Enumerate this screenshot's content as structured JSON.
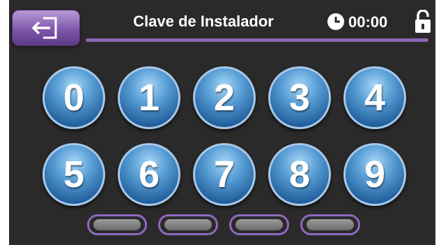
{
  "header": {
    "title": "Clave de Instalador",
    "timer": "00:00",
    "back_icon": "exit-arrow-icon",
    "clock_icon": "clock-icon",
    "lock_icon": "unlocked-padlock-icon"
  },
  "keypad": {
    "keys": [
      "0",
      "1",
      "2",
      "3",
      "4",
      "5",
      "6",
      "7",
      "8",
      "9"
    ]
  },
  "pin_slots": {
    "count": 4
  },
  "colors": {
    "accent_purple": "#7a52a8",
    "key_blue": "#2a6aab",
    "background": "#2a2a2a"
  }
}
